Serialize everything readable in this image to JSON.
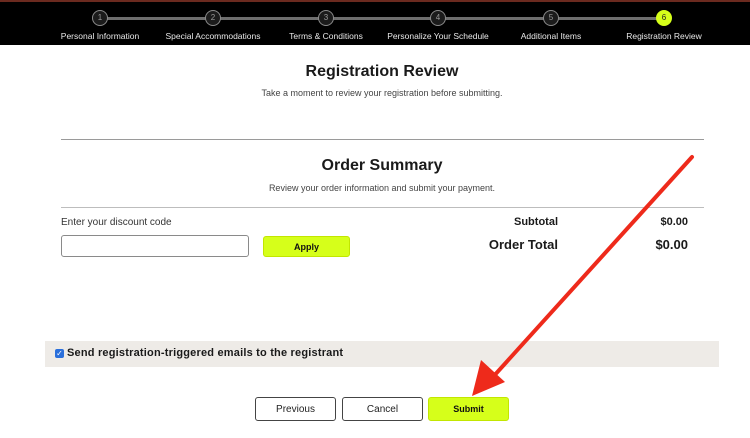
{
  "steps": [
    {
      "number": "1",
      "label": "Personal Information"
    },
    {
      "number": "2",
      "label": "Special Accommodations"
    },
    {
      "number": "3",
      "label": "Terms & Conditions"
    },
    {
      "number": "4",
      "label": "Personalize Your Schedule"
    },
    {
      "number": "5",
      "label": "Additional Items"
    },
    {
      "number": "6",
      "label": "Registration Review"
    }
  ],
  "active_step": 6,
  "review": {
    "title": "Registration Review",
    "subtitle": "Take a moment to review your registration before submitting."
  },
  "order_summary": {
    "title": "Order Summary",
    "subtitle": "Review your order information and submit your payment.",
    "discount_label": "Enter your discount code",
    "discount_value": "",
    "apply_label": "Apply",
    "subtotal_label": "Subtotal",
    "subtotal_value": "$0.00",
    "total_label": "Order Total",
    "total_value": "$0.00"
  },
  "email_option": {
    "checked": true,
    "label": "Send registration-triggered emails to the registrant"
  },
  "actions": {
    "previous_label": "Previous",
    "cancel_label": "Cancel",
    "submit_label": "Submit"
  },
  "colors": {
    "accent": "#d6ff1a",
    "header_bg": "#000000",
    "annotation_arrow": "#ee2a1b"
  }
}
